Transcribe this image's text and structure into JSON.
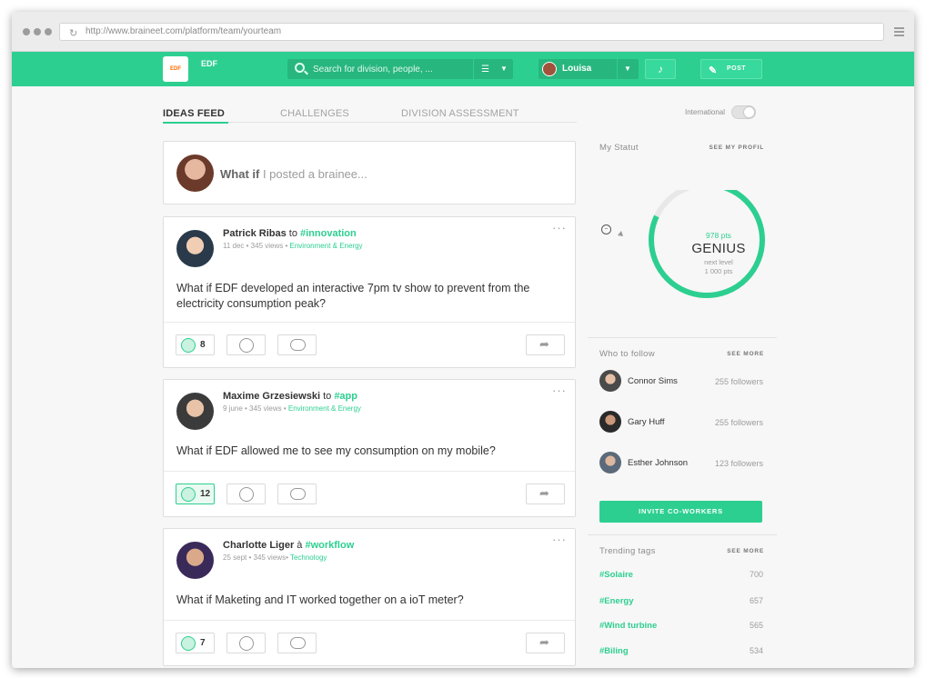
{
  "browser": {
    "url": "http://www.braineet.com/platform/team/yourteam"
  },
  "header": {
    "logo_text": "EDF",
    "brand_label": "EDF",
    "search_placeholder": "Search for division, people, ...",
    "user_name": "Louisa",
    "post_label": "POST"
  },
  "tabs": [
    {
      "label": "IDEAS FEED",
      "active": true
    },
    {
      "label": "CHALLENGES",
      "active": false
    },
    {
      "label": "DIVISION ASSESSMENT",
      "active": false
    }
  ],
  "compose": {
    "prefix": "What if",
    "placeholder": " I posted a brainee..."
  },
  "posts": [
    {
      "author": "Patrick Ribas",
      "connector": " to ",
      "tag": "#innovation",
      "meta": "11 dec • 345 views • ",
      "category": "Environment & Energy",
      "body": "What if EDF developed an interactive 7pm tv show to prevent from the electricity consumption peak?",
      "likes": "8",
      "liked": false
    },
    {
      "author": "Maxime Grzesiewski",
      "connector": " to ",
      "tag": "#app",
      "meta": "9 june • 345 views • ",
      "category": "Environment & Energy",
      "body": "What if EDF allowed me to see my consumption on my mobile?",
      "likes": "12",
      "liked": true
    },
    {
      "author": "Charlotte Liger",
      "connector": " à ",
      "tag": "#workflow",
      "meta": "25 sept • 345 views• ",
      "category": "Technology",
      "body": "What if Maketing and IT worked together on a ioT meter?",
      "likes": "7",
      "liked": false
    }
  ],
  "sidebar": {
    "international_label": "International",
    "international_on": false,
    "statut": {
      "title": "My Statut",
      "link": "SEE MY PROFIL",
      "points": "978 pts",
      "level": "GENIUS",
      "next_label": "next level",
      "next_points": "1 000 pts",
      "progress": 0.82,
      "colors": {
        "progress": "#2dcf90",
        "track": "#e8e8e8"
      }
    },
    "follow": {
      "title": "Who to follow",
      "link": "SEE MORE",
      "people": [
        {
          "name": "Connor Sims",
          "followers": "255 followers"
        },
        {
          "name": "Gary Huff",
          "followers": "255 followers"
        },
        {
          "name": "Esther Johnson",
          "followers": "123 followers"
        }
      ],
      "invite_label": "INVITE CO-WORKERS"
    },
    "trending": {
      "title": "Trending tags",
      "link": "SEE MORE",
      "tags": [
        {
          "tag": "#Solaire",
          "count": "700"
        },
        {
          "tag": "#Energy",
          "count": "657"
        },
        {
          "tag": "#Wind turbine",
          "count": "565"
        },
        {
          "tag": "#Biling",
          "count": "534"
        }
      ]
    }
  },
  "colors": {
    "accent": "#2dcf90",
    "accent_dark": "#27b67e"
  }
}
